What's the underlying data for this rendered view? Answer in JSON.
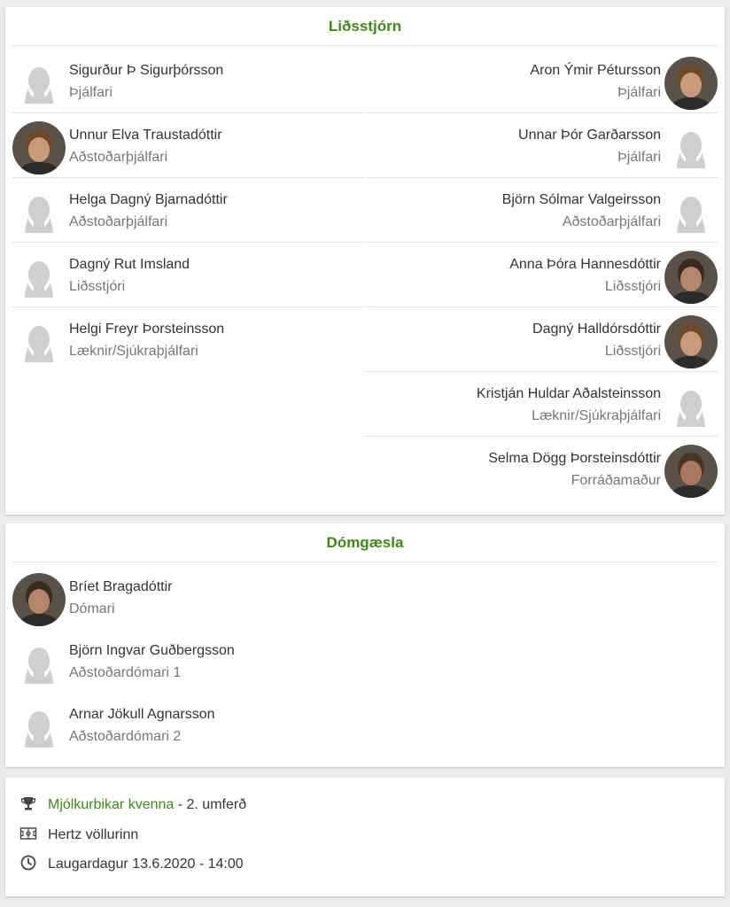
{
  "staff": {
    "title": "Liðsstjórn",
    "left": [
      {
        "name": "Sigurður Þ Sigurþórsson",
        "role": "Þjálfari",
        "photo": false
      },
      {
        "name": "Unnur Elva Traustadóttir",
        "role": "Aðstoðarþjálfari",
        "photo": true
      },
      {
        "name": "Helga Dagný Bjarnadóttir",
        "role": "Aðstoðarþjálfari",
        "photo": false
      },
      {
        "name": "Dagný Rut Imsland",
        "role": "Liðsstjóri",
        "photo": false
      },
      {
        "name": "Helgi Freyr Þorsteinsson",
        "role": "Læknir/Sjúkraþjálfari",
        "photo": false
      }
    ],
    "right": [
      {
        "name": "Aron Ýmir Pétursson",
        "role": "Þjálfari",
        "photo": true
      },
      {
        "name": "Unnar Þór Garðarsson",
        "role": "Þjálfari",
        "photo": false
      },
      {
        "name": "Björn Sólmar Valgeirsson",
        "role": "Aðstoðarþjálfari",
        "photo": false
      },
      {
        "name": "Anna Þóra Hannesdóttir",
        "role": "Liðsstjóri",
        "photo": true
      },
      {
        "name": "Dagný Halldórsdóttir",
        "role": "Liðsstjóri",
        "photo": true
      },
      {
        "name": "Kristján Huldar Aðalsteinsson",
        "role": "Læknir/Sjúkraþjálfari",
        "photo": false
      },
      {
        "name": "Selma Dögg Þorsteinsdóttir",
        "role": "Forráðamaður",
        "photo": true
      }
    ]
  },
  "referees": {
    "title": "Dómgæsla",
    "items": [
      {
        "name": "Bríet Bragadóttir",
        "role": "Dómari",
        "photo": true
      },
      {
        "name": "Björn Ingvar Guðbergsson",
        "role": "Aðstoðardómari 1",
        "photo": false
      },
      {
        "name": "Arnar Jökull Agnarsson",
        "role": "Aðstoðardómari 2",
        "photo": false
      }
    ]
  },
  "info": {
    "competition_link": "Mjólkurbikar kvenna",
    "round": " - 2. umferð",
    "venue": "Hertz völlurinn",
    "datetime": "Laugardagur 13.6.2020 - 14:00"
  },
  "colors": {
    "accent": "#3e8a17",
    "silhouette": "#cfcfcf"
  },
  "icons": {
    "competition": "trophy-icon",
    "venue": "pitch-icon",
    "time": "clock-icon"
  }
}
